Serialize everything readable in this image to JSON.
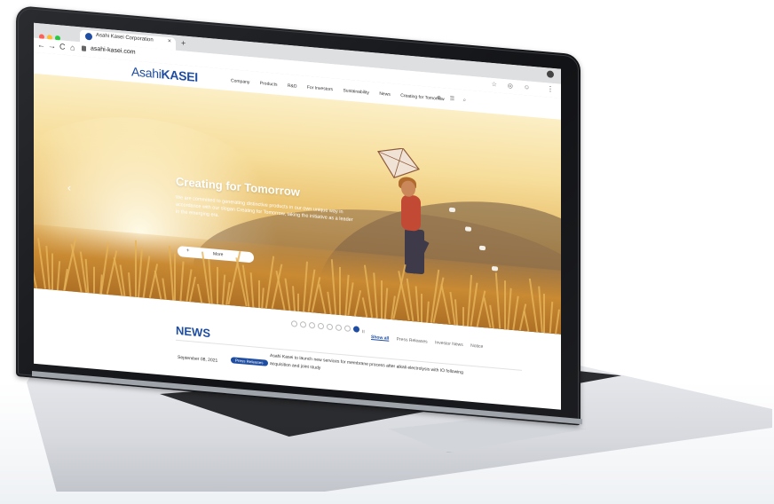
{
  "browser": {
    "tab_title": "Asahi Kasei Corporation",
    "tab_close": "×",
    "new_tab": "+",
    "url": "asahi-kasei.com",
    "back": "←",
    "forward": "→",
    "reload": "C",
    "home": "⌂",
    "url_icons": "☆ ◎ ☺",
    "menu": "⋮"
  },
  "site": {
    "logo_regular": "Asahi",
    "logo_bold": "KASEI",
    "nav": [
      "Company",
      "Products",
      "R&D",
      "For Investors",
      "Sustainability",
      "News",
      "Creating for Tomorrow"
    ],
    "header_icons": "⊕ ☰ ⌕"
  },
  "hero": {
    "title": "Creating for Tomorrow",
    "text": "We are committed to generating distinctive products in our own unique way in accordance with our slogan Creating for Tomorrow, taking the initiative as a leader in the emerging era.",
    "more_plus": "+",
    "more_label": "More",
    "prev_arrow": "‹"
  },
  "pager": {
    "count": 8,
    "active_index": 7,
    "pause": "II"
  },
  "news": {
    "title": "NEWS",
    "tabs": [
      "Show all",
      "Press Releases",
      "Investor News",
      "Notice"
    ],
    "item": {
      "date": "September 08, 2021",
      "badge": "Press Releases",
      "text": "Asahi Kasei to launch new services for membrane process after alkali electrolysis with IO following acquisition and joint study"
    }
  },
  "colors": {
    "brand_blue": "#1e4da1",
    "close_red": "#fe5f57",
    "min_yellow": "#febc2e",
    "max_green": "#28c840"
  }
}
